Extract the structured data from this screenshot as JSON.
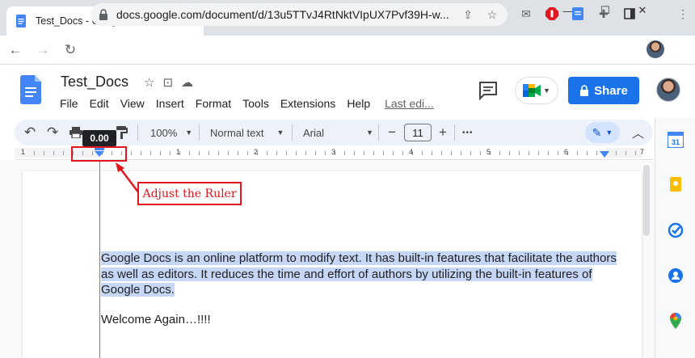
{
  "browser": {
    "tab_title": "Test_Docs - Google Docs",
    "tab_close": "✕",
    "new_tab": "+",
    "window_controls": {
      "minimize": "—",
      "maximize": "☐",
      "close": "✕"
    },
    "url": "docs.google.com/document/d/13u5TTvJ4RtNktVIpUX7Pvf39H-w..."
  },
  "docs": {
    "title": "Test_Docs",
    "menu": [
      "File",
      "Edit",
      "View",
      "Insert",
      "Format",
      "Tools",
      "Extensions",
      "Help"
    ],
    "last_edit": "Last edi...",
    "share_label": "Share"
  },
  "toolbar": {
    "zoom": "100%",
    "style": "Normal text",
    "font": "Arial",
    "font_size": "11",
    "minus": "−",
    "plus": "+",
    "more": "•••"
  },
  "ruler": {
    "labels": [
      "1",
      "1",
      "2",
      "3",
      "4",
      "5",
      "6",
      "7"
    ],
    "indent_value": "0.00"
  },
  "document": {
    "paragraph_line1": "Google Docs is an online platform to modify text. It has built-in features that facilitate the authors",
    "paragraph_line2": "as well as editors. It reduces the time and effort of authors by utilizing the built-in features of",
    "paragraph_line3": "Google Docs.",
    "welcome": "Welcome Again…!!!!"
  },
  "annotation": {
    "callout": "Adjust the Ruler"
  },
  "colors": {
    "docs_blue": "#4285f4",
    "share_blue": "#1a73e8",
    "annotation_red": "#e0171e",
    "selection": "#c6d7f5"
  }
}
